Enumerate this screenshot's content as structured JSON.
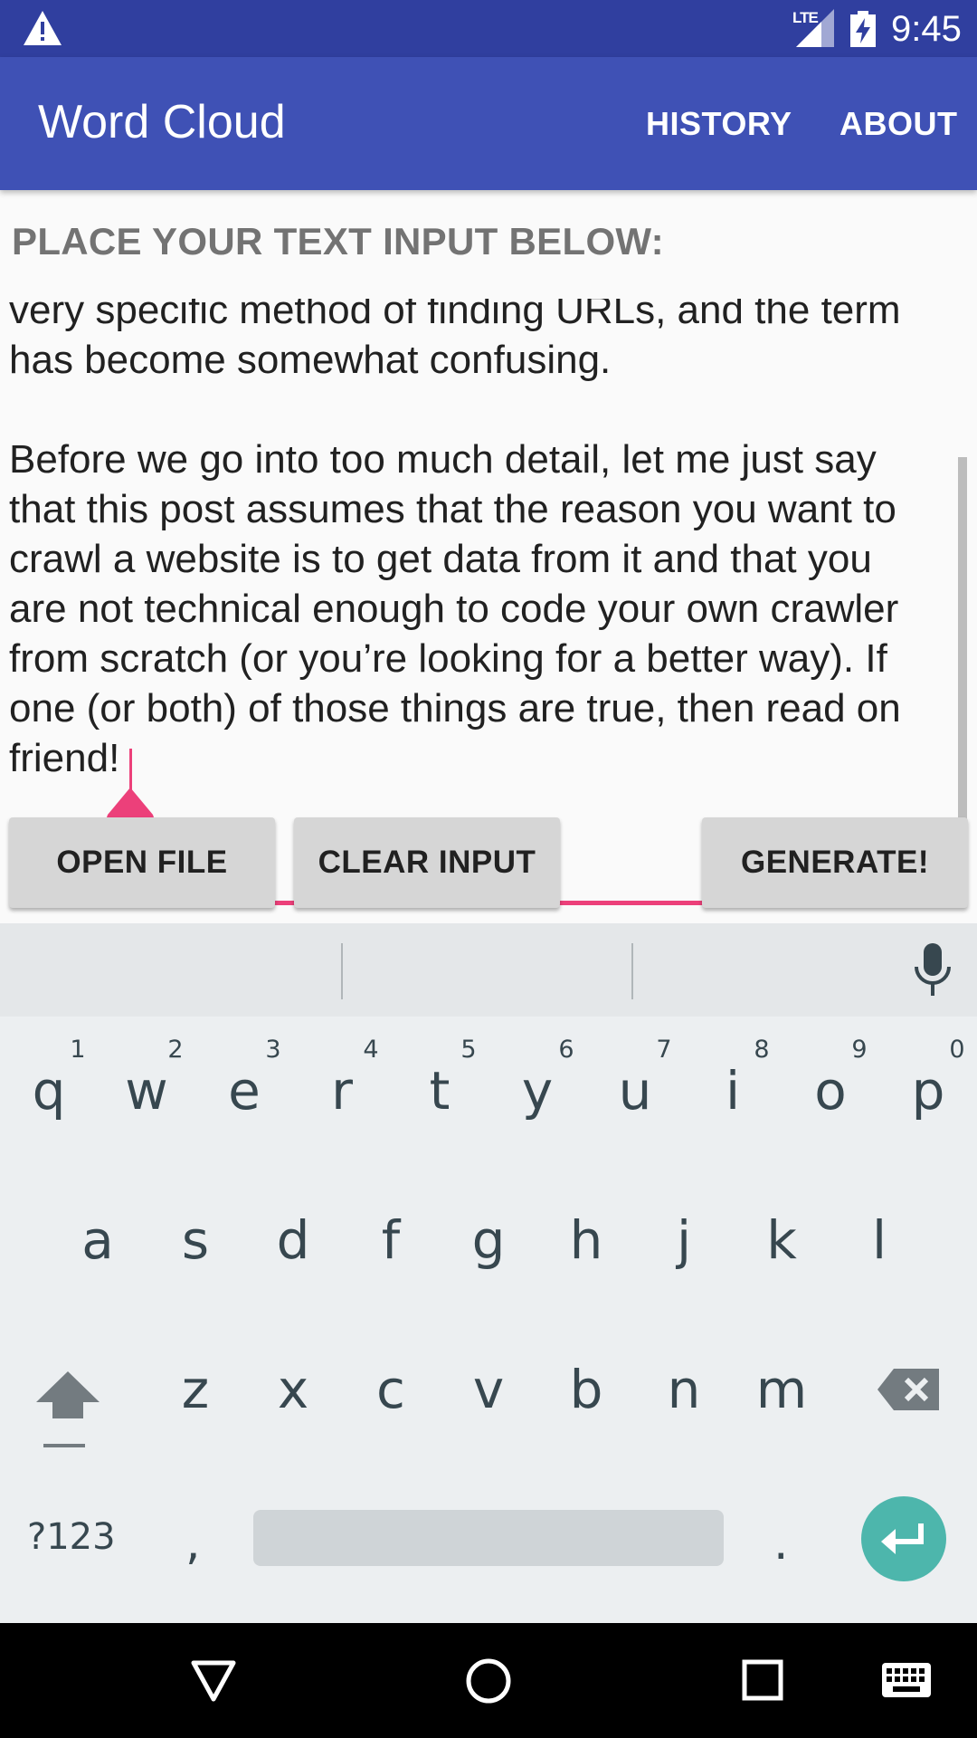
{
  "status_bar": {
    "time": "9:45",
    "network_label": "LTE",
    "icons": [
      "warning-icon",
      "signal-icon",
      "battery-charging-icon"
    ]
  },
  "app_bar": {
    "title": "Word Cloud",
    "menu": [
      {
        "label": "HISTORY"
      },
      {
        "label": "ABOUT"
      }
    ]
  },
  "main": {
    "heading": "PLACE YOUR TEXT INPUT BELOW:",
    "input_text": "very specific method of finding URLs, and the term\nhas become somewhat confusing.\n\nBefore we go into too much detail, let me just say\nthat this post assumes that the reason you want to\ncrawl a website is to get data from it and that you\nare not technical enough to code your own crawler\nfrom scratch (or you’re looking for a better way). If\none (or both) of those things are true, then read on\nfriend!",
    "buttons": {
      "open_file": "OPEN FILE",
      "clear_input": "CLEAR INPUT",
      "generate": "GENERATE!"
    },
    "accent_color": "#ec407a"
  },
  "keyboard": {
    "row1": [
      "q",
      "w",
      "e",
      "r",
      "t",
      "y",
      "u",
      "i",
      "o",
      "p"
    ],
    "row1_hints": [
      "1",
      "2",
      "3",
      "4",
      "5",
      "6",
      "7",
      "8",
      "9",
      "0"
    ],
    "row2": [
      "a",
      "s",
      "d",
      "f",
      "g",
      "h",
      "j",
      "k",
      "l"
    ],
    "row3": [
      "z",
      "x",
      "c",
      "v",
      "b",
      "n",
      "m"
    ],
    "symbols_label": "?123",
    "comma": ",",
    "period": ".",
    "enter_color": "#4db6ac"
  },
  "nav_bar": {
    "icons": [
      "back-icon",
      "home-icon",
      "recents-icon",
      "keyboard-switch-icon"
    ]
  }
}
